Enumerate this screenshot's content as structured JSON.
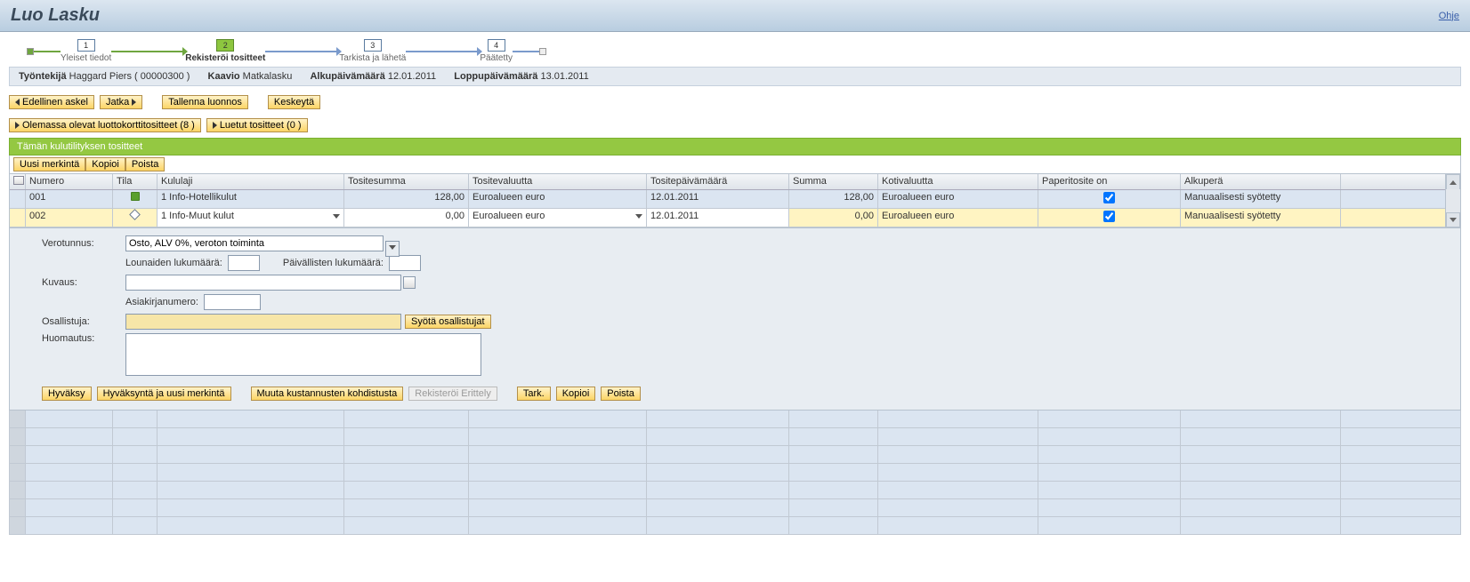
{
  "header": {
    "title": "Luo Lasku",
    "help": "Ohje"
  },
  "wizard": {
    "steps": [
      {
        "num": "1",
        "label": "Yleiset tiedot"
      },
      {
        "num": "2",
        "label": "Rekisteröi tositteet"
      },
      {
        "num": "3",
        "label": "Tarkista ja lähetä"
      },
      {
        "num": "4",
        "label": "Päätetty"
      }
    ],
    "active_index": 1
  },
  "info": {
    "employee_label": "Työntekijä",
    "employee_value": "Haggard Piers ( 00000300 )",
    "schema_label": "Kaavio",
    "schema_value": "Matkalasku",
    "start_label": "Alkupäivämäärä",
    "start_value": "12.01.2011",
    "end_label": "Loppupäivämäärä",
    "end_value": "13.01.2011"
  },
  "actions": {
    "prev": "Edellinen askel",
    "next": "Jatka",
    "save_draft": "Tallenna luonnos",
    "cancel": "Keskeytä"
  },
  "toggles": {
    "cc_receipts": "Olemassa olevat luottokorttitositteet (8 )",
    "read_receipts": "Luetut tositteet (0 )"
  },
  "section_title": "Tämän kulutilityksen tositteet",
  "toolbar": {
    "new": "Uusi merkintä",
    "copy": "Kopioi",
    "delete": "Poista"
  },
  "columns": {
    "numero": "Numero",
    "tila": "Tila",
    "kululaji": "Kululaji",
    "tositesumma": "Tositesumma",
    "tositevaluutta": "Tositevaluutta",
    "tositepvm": "Tositepäivämäärä",
    "summa": "Summa",
    "kotivaluutta": "Kotivaluutta",
    "paperitosite": "Paperitosite on",
    "alkupera": "Alkuperä"
  },
  "rows": [
    {
      "numero": "001",
      "tila": "ok",
      "kululaji": "1 Info-Hotellikulut",
      "tositesumma": "128,00",
      "tositevaluutta": "Euroalueen euro",
      "tositepvm": "12.01.2011",
      "summa": "128,00",
      "kotivaluutta": "Euroalueen euro",
      "paperitosite": true,
      "alkupera": "Manuaalisesti syötetty"
    },
    {
      "numero": "002",
      "tila": "edit",
      "kululaji": "1 Info-Muut kulut",
      "tositesumma": "0,00",
      "tositevaluutta": "Euroalueen euro",
      "tositepvm": "12.01.2011",
      "summa": "0,00",
      "kotivaluutta": "Euroalueen euro",
      "paperitosite": true,
      "alkupera": "Manuaalisesti syötetty"
    }
  ],
  "detail": {
    "verotunnus_label": "Verotunnus:",
    "verotunnus_value": "Osto, ALV 0%, veroton toiminta",
    "lounaiden_label": "Lounaiden lukumäärä:",
    "paivallisten_label": "Päivällisten lukumäärä:",
    "kuvaus_label": "Kuvaus:",
    "asiakirja_label": "Asiakirjanumero:",
    "osallistuja_label": "Osallistuja:",
    "syota_osallistujat": "Syötä osallistujat",
    "huomautus_label": "Huomautus:",
    "hyvaksy": "Hyväksy",
    "hyvaksy_ja_uusi": "Hyväksyntä ja uusi merkintä",
    "muuta_kustannusten": "Muuta kustannusten kohdistusta",
    "rekisteroi_erittely": "Rekisteröi Erittely",
    "tark": "Tark.",
    "kopioi": "Kopioi",
    "poista": "Poista"
  }
}
